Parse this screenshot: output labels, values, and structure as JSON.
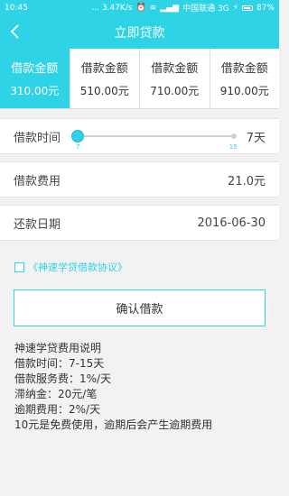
{
  "status_bar": {
    "time": "10:45",
    "speed": "... 3.47K/s",
    "carrier": "中国联通 3G",
    "battery": "87%"
  },
  "nav": {
    "title": "立即贷款"
  },
  "amounts": [
    {
      "label": "借款金额",
      "value": "310.00元",
      "selected": true
    },
    {
      "label": "借款金额",
      "value": "510.00元",
      "selected": false
    },
    {
      "label": "借款金额",
      "value": "710.00元",
      "selected": false
    },
    {
      "label": "借款金额",
      "value": "910.00元",
      "selected": false
    }
  ],
  "loan_time": {
    "label": "借款时间",
    "value": "7天",
    "min_tick": "7",
    "max_tick": "15",
    "slider_fraction": 0
  },
  "loan_fee": {
    "label": "借款费用",
    "value": "21.0元"
  },
  "repay_date": {
    "label": "还款日期",
    "value": "2016-06-30"
  },
  "agreement": {
    "link": "《神速学贷借款协议》"
  },
  "confirm_button": "确认借款",
  "notes": {
    "title": "神速学贷费用说明",
    "lines": [
      "借款时间：7-15天",
      "借款服务费：1%/天",
      "滞纳金：20元/笔",
      "逾期费用：2%/天",
      "10元是免费使用，逾期后会产生逾期费用"
    ]
  },
  "colors": {
    "accent": "#2fd3e6"
  }
}
